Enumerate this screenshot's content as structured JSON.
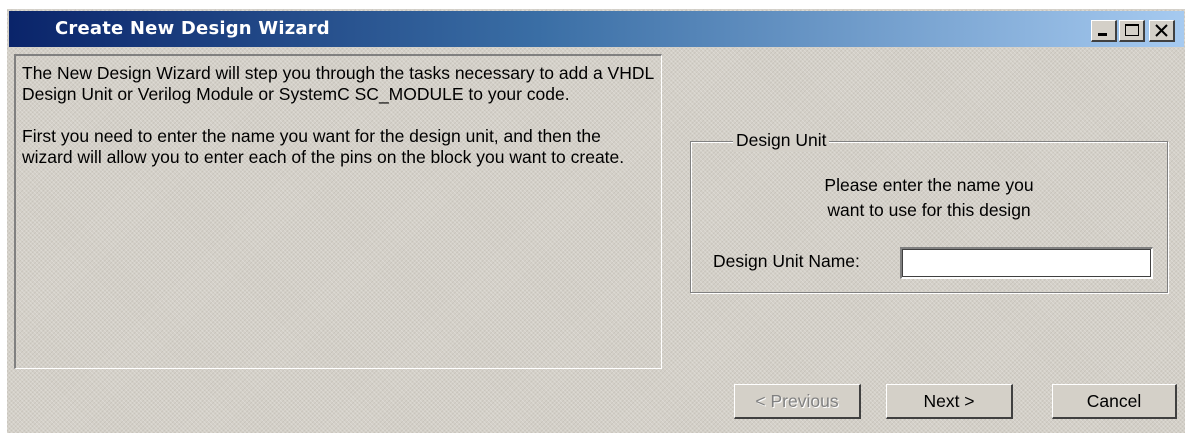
{
  "window": {
    "title": "Create New Design Wizard",
    "controls": {
      "minimize_icon": "minimize-icon",
      "maximize_icon": "maximize-icon",
      "close_icon": "close-icon"
    }
  },
  "info": {
    "paragraph1": "The New Design Wizard will step you through the tasks necessary to add a VHDL Design Unit or Verilog Module or SystemC SC_MODULE to your code.",
    "paragraph2": "First you need to enter the name you want for the design unit, and then the wizard will allow you to enter each of the pins on the block you want to create."
  },
  "design_unit": {
    "legend": "Design Unit",
    "instruction_line1": "Please enter the name you",
    "instruction_line2": "want to use for this design",
    "name_label": "Design Unit Name:",
    "name_value": ""
  },
  "buttons": {
    "previous": "< Previous",
    "next": "Next >",
    "cancel": "Cancel"
  },
  "colors": {
    "titlebar_start": "#0a246a",
    "titlebar_end": "#a6caf0",
    "face": "#d4d0c8"
  }
}
